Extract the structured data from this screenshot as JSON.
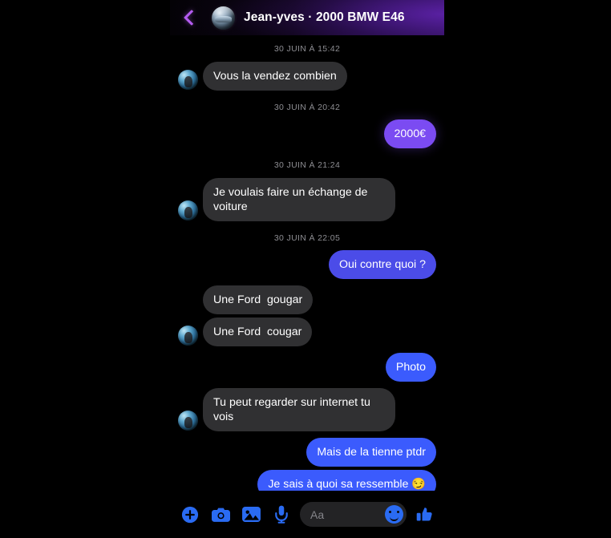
{
  "header": {
    "back_icon": "chevron-left-icon",
    "avatar_icon": "contact-avatar",
    "title": "Jean-yves · 2000 BMW E46"
  },
  "thread": [
    {
      "kind": "timestamp",
      "text": "30 JUIN À 15:42"
    },
    {
      "kind": "message",
      "side": "in",
      "color": "grey",
      "text": "Vous la vendez combien",
      "avatar": true
    },
    {
      "kind": "timestamp",
      "text": "30 JUIN À 20:42"
    },
    {
      "kind": "message",
      "side": "out",
      "color": "purple",
      "text": "2000€"
    },
    {
      "kind": "timestamp",
      "text": "30 JUIN À 21:24"
    },
    {
      "kind": "message",
      "side": "in",
      "color": "grey",
      "text": "Je voulais faire un échange de voiture",
      "avatar": true
    },
    {
      "kind": "timestamp",
      "text": "30 JUIN À 22:05"
    },
    {
      "kind": "message",
      "side": "out",
      "color": "indigo",
      "text": "Oui contre quoi ?"
    },
    {
      "kind": "message",
      "side": "in",
      "color": "grey",
      "text": "Une Ford  gougar",
      "avatar": false
    },
    {
      "kind": "message",
      "side": "in",
      "color": "grey",
      "text": "Une Ford  cougar",
      "avatar": true
    },
    {
      "kind": "message",
      "side": "out",
      "color": "blue",
      "text": "Photo"
    },
    {
      "kind": "message",
      "side": "in",
      "color": "grey",
      "text": "Tu peut regarder sur internet tu vois",
      "avatar": true
    },
    {
      "kind": "message",
      "side": "out",
      "color": "blue",
      "text": "Mais de la tienne ptdr"
    },
    {
      "kind": "message",
      "side": "out",
      "color": "blue",
      "text": "Je sais à quoi sa ressemble 😏"
    },
    {
      "kind": "receipt",
      "avatar_icon": "read-receipt-avatar"
    }
  ],
  "composer": {
    "tools": [
      {
        "id": "plus-circle-icon",
        "label": "Plus"
      },
      {
        "id": "camera-icon",
        "label": "Camera"
      },
      {
        "id": "gallery-icon",
        "label": "Gallery"
      },
      {
        "id": "microphone-icon",
        "label": "Microphone"
      }
    ],
    "input_placeholder": "Aa",
    "emoji_icon": "smiley-icon",
    "like_icon": "thumbs-up-icon"
  },
  "colors": {
    "background": "#000000",
    "bubble_grey": "#303032",
    "bubble_purple": "#7b4bf2",
    "bubble_indigo": "#4b4ce8",
    "bubble_blue": "#3b5bfd",
    "accent_blue": "#2a6bf2",
    "back_chevron": "#b45cf0",
    "timestamp_text": "#8d8d92"
  }
}
